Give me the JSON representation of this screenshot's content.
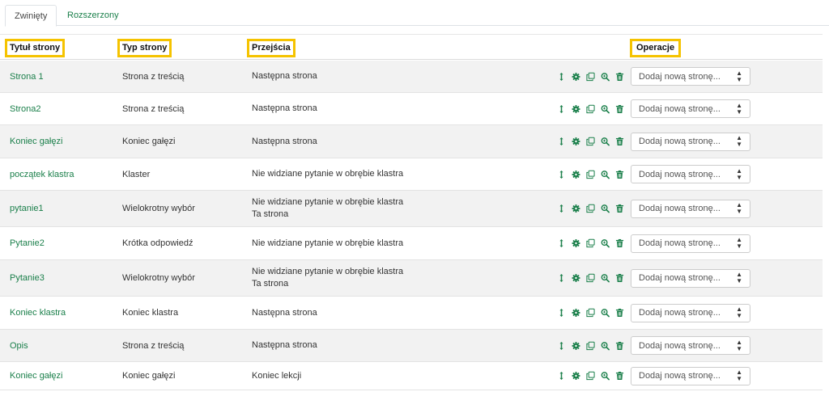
{
  "tabs": [
    {
      "label": "Zwinięty",
      "active": true
    },
    {
      "label": "Rozszerzony",
      "active": false
    }
  ],
  "headers": {
    "title": "Tytuł strony",
    "type": "Typ strony",
    "transitions": "Przejścia",
    "operations": "Operacje"
  },
  "colors": {
    "accent": "#1a7f4a",
    "highlight": "#f5c300"
  },
  "icons": [
    "move-icon",
    "gear-icon",
    "copy-icon",
    "zoom-icon",
    "trash-icon"
  ],
  "rows": [
    {
      "title": "Strona 1",
      "type": "Strona z treścią",
      "transitions": [
        "Następna strona"
      ],
      "select": "Dodaj nową stronę..."
    },
    {
      "title": "Strona2",
      "type": "Strona z treścią",
      "transitions": [
        "Następna strona"
      ],
      "select": "Dodaj nową stronę..."
    },
    {
      "title": "Koniec gałęzi",
      "type": "Koniec gałęzi",
      "transitions": [
        "Następna strona"
      ],
      "select": "Dodaj nową stronę..."
    },
    {
      "title": "początek klastra",
      "type": "Klaster",
      "transitions": [
        "Nie widziane pytanie w obrębie klastra"
      ],
      "select": "Dodaj nową stronę..."
    },
    {
      "title": "pytanie1",
      "type": "Wielokrotny wybór",
      "transitions": [
        "Nie widziane pytanie w obrębie klastra",
        "Ta strona"
      ],
      "select": "Dodaj nową stronę..."
    },
    {
      "title": "Pytanie2",
      "type": "Krótka odpowiedź",
      "transitions": [
        "Nie widziane pytanie w obrębie klastra"
      ],
      "select": "Dodaj nową stronę..."
    },
    {
      "title": "Pytanie3",
      "type": "Wielokrotny wybór",
      "transitions": [
        "Nie widziane pytanie w obrębie klastra",
        "Ta strona"
      ],
      "select": "Dodaj nową stronę..."
    },
    {
      "title": "Koniec klastra",
      "type": "Koniec klastra",
      "transitions": [
        "Następna strona"
      ],
      "select": "Dodaj nową stronę..."
    },
    {
      "title": "Opis",
      "type": "Strona z treścią",
      "transitions": [
        "Następna strona"
      ],
      "select": "Dodaj nową stronę..."
    },
    {
      "title": "Koniec gałęzi",
      "type": "Koniec gałęzi",
      "transitions": [
        "Koniec lekcji"
      ],
      "select": "Dodaj nową stronę..."
    }
  ]
}
